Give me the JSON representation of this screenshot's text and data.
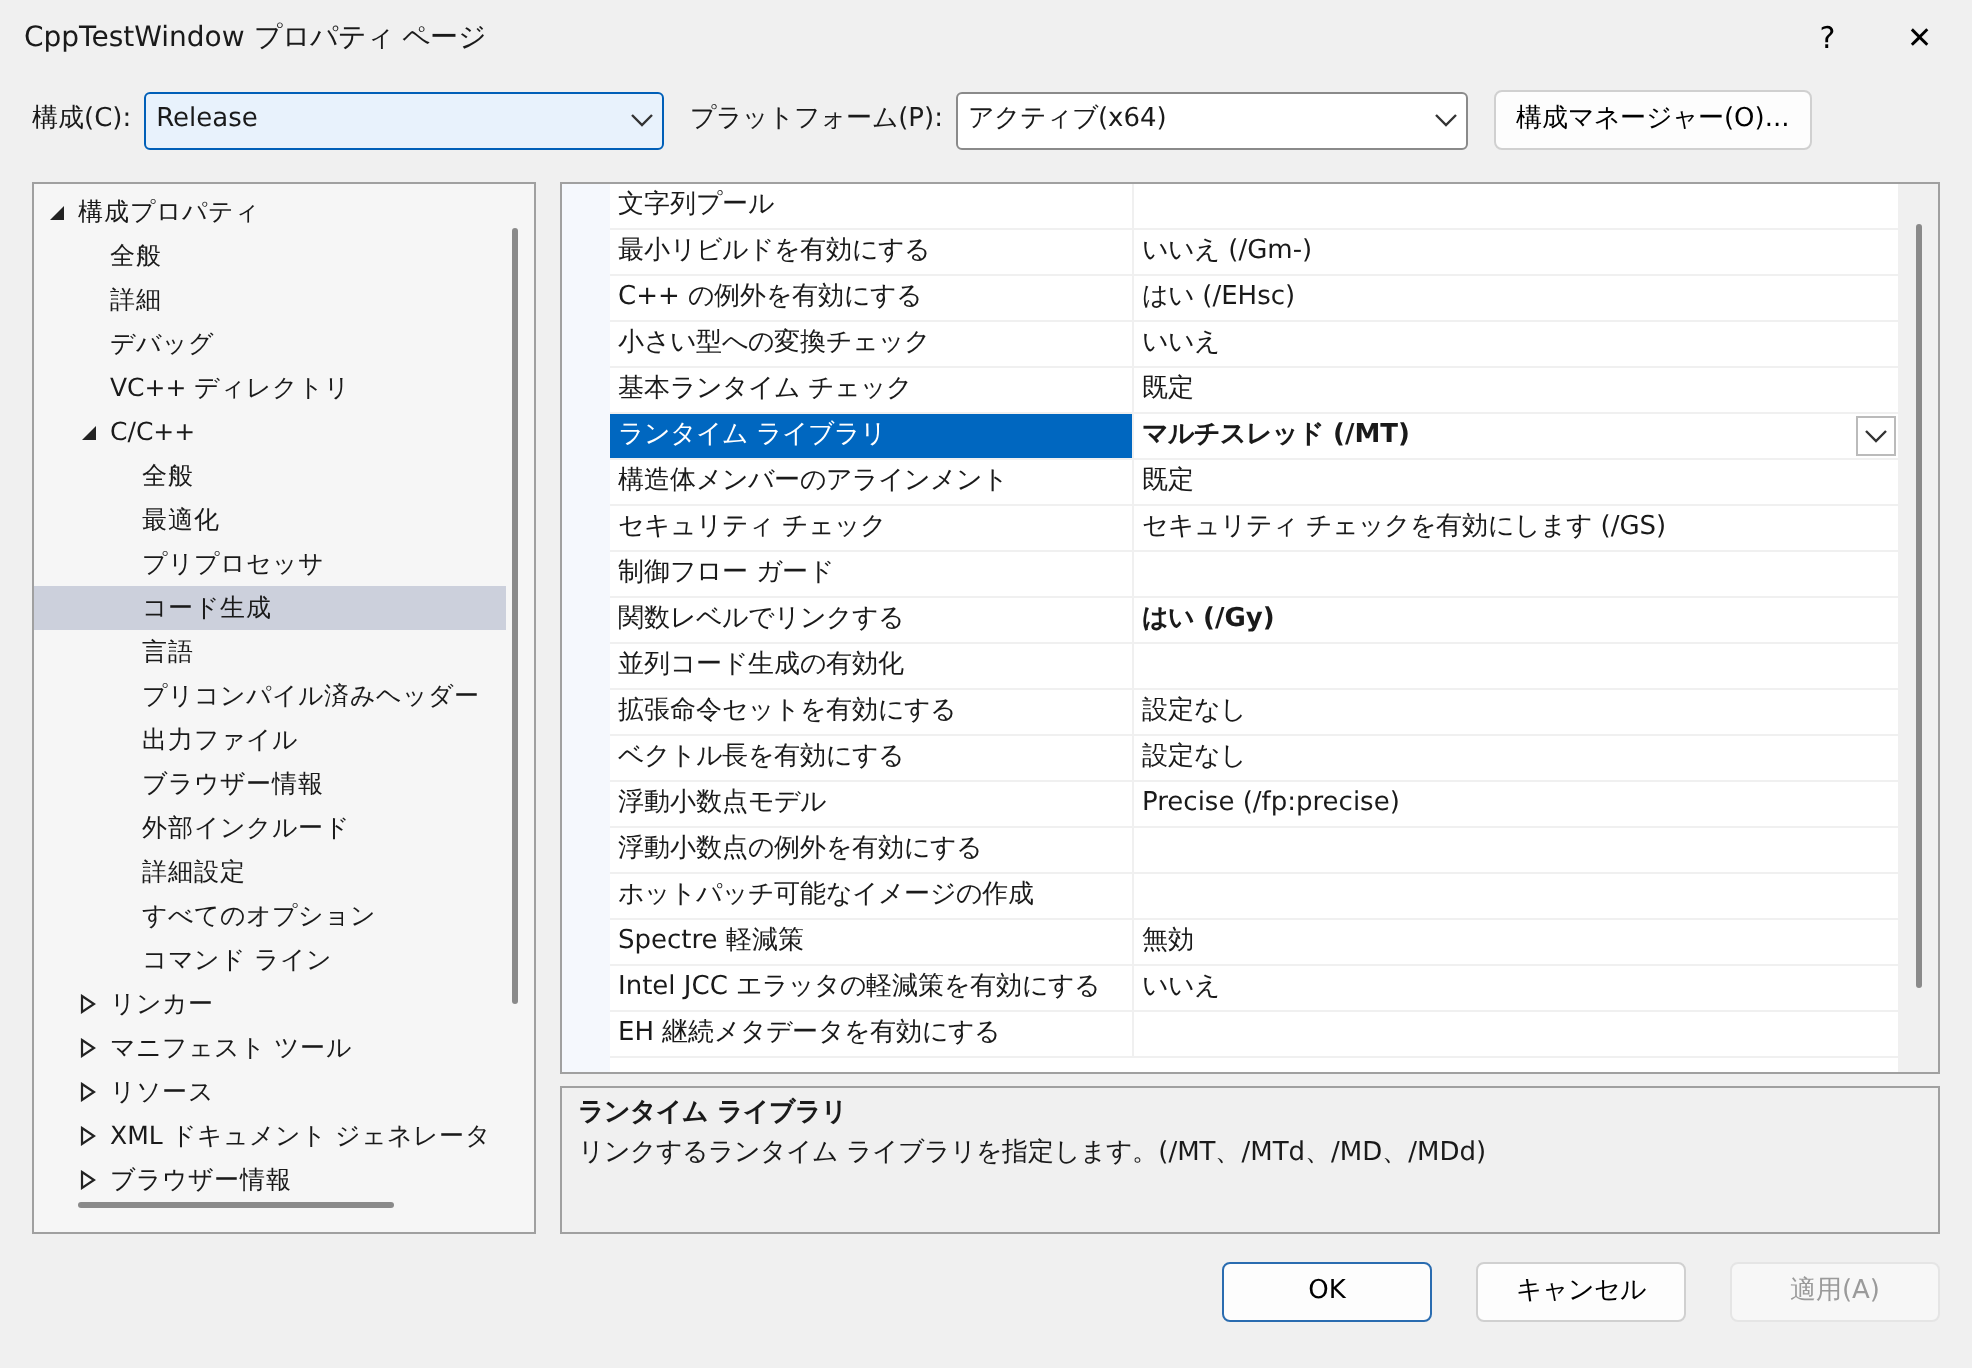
{
  "window": {
    "title": "CppTestWindow プロパティ ページ",
    "help": "?",
    "close": "✕"
  },
  "config": {
    "label": "構成(C):",
    "value": "Release",
    "platform_label": "プラットフォーム(P):",
    "platform_value": "アクティブ(x64)",
    "manager_button": "構成マネージャー(O)..."
  },
  "tree": [
    {
      "label": "構成プロパティ",
      "expanded": true,
      "selected": false,
      "children": [
        {
          "label": "全般",
          "selected": false
        },
        {
          "label": "詳細",
          "selected": false
        },
        {
          "label": "デバッグ",
          "selected": false
        },
        {
          "label": "VC++ ディレクトリ",
          "selected": false
        },
        {
          "label": "C/C++",
          "expanded": true,
          "selected": false,
          "children": [
            {
              "label": "全般",
              "selected": false
            },
            {
              "label": "最適化",
              "selected": false
            },
            {
              "label": "プリプロセッサ",
              "selected": false
            },
            {
              "label": "コード生成",
              "selected": true
            },
            {
              "label": "言語",
              "selected": false
            },
            {
              "label": "プリコンパイル済みヘッダー",
              "selected": false
            },
            {
              "label": "出力ファイル",
              "selected": false
            },
            {
              "label": "ブラウザー情報",
              "selected": false
            },
            {
              "label": "外部インクルード",
              "selected": false
            },
            {
              "label": "詳細設定",
              "selected": false
            },
            {
              "label": "すべてのオプション",
              "selected": false
            },
            {
              "label": "コマンド ライン",
              "selected": false
            }
          ]
        },
        {
          "label": "リンカー",
          "expanded": false,
          "selected": false
        },
        {
          "label": "マニフェスト ツール",
          "expanded": false,
          "selected": false
        },
        {
          "label": "リソース",
          "expanded": false,
          "selected": false
        },
        {
          "label": "XML ドキュメント ジェネレータ",
          "expanded": false,
          "selected": false
        },
        {
          "label": "ブラウザー情報",
          "expanded": false,
          "selected": false
        }
      ]
    }
  ],
  "properties": [
    {
      "name": "文字列プール",
      "modified": false,
      "selected": false
    },
    {
      "name": "最小リビルドを有効にする",
      "value": "いいえ (/Gm-)",
      "modified": false,
      "selected": false
    },
    {
      "name": "C++ の例外を有効にする",
      "value": "はい (/EHsc)",
      "modified": false,
      "selected": false
    },
    {
      "name": "小さい型への変換チェック",
      "value": "いいえ",
      "modified": false,
      "selected": false
    },
    {
      "name": "基本ランタイム チェック",
      "value": "既定",
      "modified": false,
      "selected": false
    },
    {
      "name": "ランタイム ライブラリ",
      "value": "マルチスレッド (/MT)",
      "modified": true,
      "selected": true
    },
    {
      "name": "構造体メンバーのアラインメント",
      "value": "既定",
      "modified": false,
      "selected": false
    },
    {
      "name": "セキュリティ チェック",
      "value": "セキュリティ チェックを有効にします (/GS)",
      "modified": false,
      "selected": false
    },
    {
      "name": "制御フロー ガード",
      "modified": false,
      "selected": false
    },
    {
      "name": "関数レベルでリンクする",
      "value": "はい (/Gy)",
      "modified": true,
      "selected": false
    },
    {
      "name": "並列コード生成の有効化",
      "modified": false,
      "selected": false
    },
    {
      "name": "拡張命令セットを有効にする",
      "value": "設定なし",
      "modified": false,
      "selected": false
    },
    {
      "name": "ベクトル長を有効にする",
      "value": "設定なし",
      "modified": false,
      "selected": false
    },
    {
      "name": "浮動小数点モデル",
      "value": "Precise (/fp:precise)",
      "modified": false,
      "selected": false
    },
    {
      "name": "浮動小数点の例外を有効にする",
      "modified": false,
      "selected": false
    },
    {
      "name": "ホットパッチ可能なイメージの作成",
      "modified": false,
      "selected": false
    },
    {
      "name": "Spectre 軽減策",
      "value": "無効",
      "modified": false,
      "selected": false
    },
    {
      "name": "Intel JCC エラッタの軽減策を有効にする",
      "value": "いいえ",
      "modified": false,
      "selected": false
    },
    {
      "name": "EH 継続メタデータを有効にする",
      "modified": false,
      "selected": false
    }
  ],
  "description": {
    "title": "ランタイム ライブラリ",
    "text": "リンクするランタイム ライブラリを指定します。(/MT、/MTd、/MD、/MDd)"
  },
  "buttons": [
    {
      "label": "OK",
      "kind": "default",
      "disabled": false
    },
    {
      "label": "キャンセル",
      "kind": "normal",
      "disabled": false
    },
    {
      "label": "適用(A)",
      "kind": "normal",
      "disabled": true
    }
  ]
}
